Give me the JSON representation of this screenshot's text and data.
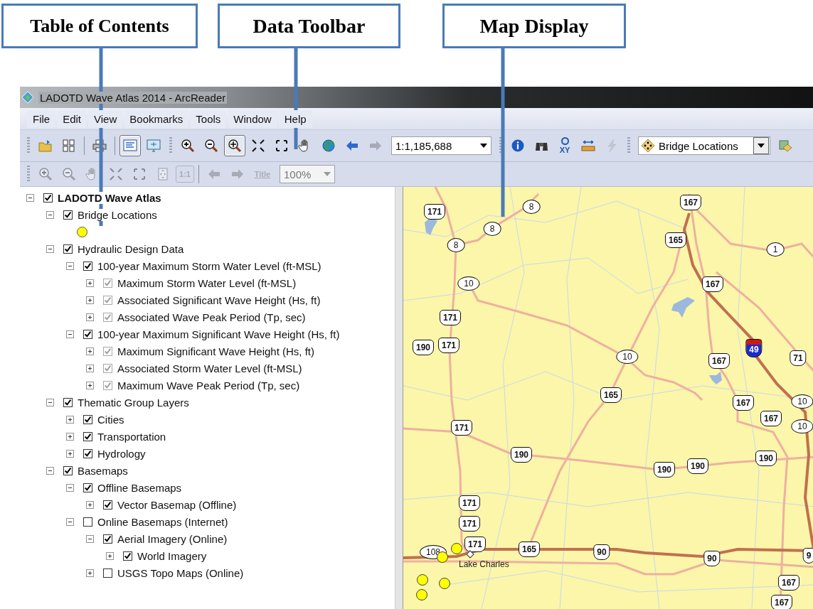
{
  "callouts": [
    {
      "text": "Table of Contents"
    },
    {
      "text": "Data Toolbar"
    },
    {
      "text": "Map Display"
    }
  ],
  "window": {
    "title": "LADOTD Wave Atlas 2014 - ArcReader"
  },
  "menu": [
    "File",
    "Edit",
    "View",
    "Bookmarks",
    "Tools",
    "Window",
    "Help"
  ],
  "toolbar_rows": [
    [
      {
        "kind": "grip"
      },
      {
        "kind": "open",
        "pressed": false,
        "disabled": false
      },
      {
        "kind": "pages",
        "pressed": false,
        "disabled": false
      },
      {
        "kind": "separator"
      },
      {
        "kind": "print",
        "pressed": false,
        "disabled": false
      },
      {
        "kind": "separator"
      },
      {
        "kind": "toc-view",
        "pressed": true,
        "disabled": false
      },
      {
        "kind": "data-view",
        "pressed": false,
        "disabled": false
      },
      {
        "kind": "grip"
      },
      {
        "kind": "zoom-in",
        "pressed": false,
        "disabled": false
      },
      {
        "kind": "zoom-out",
        "pressed": false,
        "disabled": false
      },
      {
        "kind": "pan-zoom",
        "pressed": true,
        "disabled": false
      },
      {
        "kind": "fixed-zoom-in",
        "pressed": false,
        "disabled": false
      },
      {
        "kind": "fixed-zoom-out",
        "pressed": false,
        "disabled": false
      },
      {
        "kind": "pan",
        "pressed": false,
        "disabled": false
      },
      {
        "kind": "full-extent",
        "pressed": false,
        "disabled": false
      },
      {
        "kind": "back",
        "pressed": false,
        "disabled": false
      },
      {
        "kind": "forward",
        "pressed": false,
        "disabled": true
      },
      {
        "kind": "combo",
        "value": "1:1,185,688",
        "disabled": false
      },
      {
        "kind": "grip"
      },
      {
        "kind": "identify",
        "pressed": false,
        "disabled": false
      },
      {
        "kind": "find",
        "pressed": false,
        "disabled": false
      },
      {
        "kind": "xy",
        "label": "XY",
        "pressed": false,
        "disabled": false
      },
      {
        "kind": "measure",
        "pressed": false,
        "disabled": false
      },
      {
        "kind": "flash",
        "pressed": false,
        "disabled": true
      },
      {
        "kind": "grip"
      },
      {
        "kind": "layer-combo",
        "value": "Bridge Locations",
        "disabled": false
      },
      {
        "kind": "layer-tool",
        "pressed": false,
        "disabled": false
      }
    ],
    [
      {
        "kind": "grip"
      },
      {
        "kind": "zoom-in",
        "pressed": false,
        "disabled": true
      },
      {
        "kind": "zoom-out",
        "pressed": false,
        "disabled": true
      },
      {
        "kind": "pan",
        "pressed": false,
        "disabled": true
      },
      {
        "kind": "fixed-zoom-in",
        "pressed": false,
        "disabled": true
      },
      {
        "kind": "fixed-zoom-out",
        "pressed": false,
        "disabled": true
      },
      {
        "kind": "whole-page",
        "pressed": false,
        "disabled": true
      },
      {
        "kind": "ratio",
        "label": "1:1",
        "pressed": false,
        "disabled": true
      },
      {
        "kind": "separator"
      },
      {
        "kind": "back",
        "pressed": false,
        "disabled": true
      },
      {
        "kind": "forward",
        "pressed": false,
        "disabled": true
      },
      {
        "kind": "text-tool",
        "label": "Title",
        "pressed": false,
        "disabled": true
      },
      {
        "kind": "combo",
        "value": "100%",
        "disabled": true
      }
    ]
  ],
  "toc": {
    "items": [
      {
        "kind": "layer",
        "label": "LADOTD Wave Atlas",
        "checked": true,
        "disabled": false,
        "expanded": true,
        "children": [
          {
            "kind": "layer",
            "label": "Bridge Locations",
            "checked": true,
            "disabled": false,
            "expanded": true,
            "children": [
              {
                "kind": "legend"
              }
            ]
          },
          {
            "kind": "layer",
            "label": "Hydraulic Design Data",
            "checked": true,
            "disabled": false,
            "expanded": true,
            "children": [
              {
                "kind": "layer",
                "label": "100-year Maximum Storm Water Level (ft-MSL)",
                "checked": true,
                "disabled": false,
                "expanded": true,
                "children": [
                  {
                    "kind": "layer",
                    "label": "Maximum Storm Water Level (ft-MSL)",
                    "checked": true,
                    "disabled": true,
                    "expanded": false
                  },
                  {
                    "kind": "layer",
                    "label": "Associated  Significant Wave Height (Hs, ft)",
                    "checked": true,
                    "disabled": true,
                    "expanded": false
                  },
                  {
                    "kind": "layer",
                    "label": "Associated Wave Peak Period (Tp, sec)",
                    "checked": true,
                    "disabled": true,
                    "expanded": false
                  }
                ]
              },
              {
                "kind": "layer",
                "label": "100-year Maximum Significant Wave Height (Hs, ft)",
                "checked": true,
                "disabled": false,
                "expanded": true,
                "children": [
                  {
                    "kind": "layer",
                    "label": "Maximum Significant Wave Height (Hs, ft)",
                    "checked": true,
                    "disabled": true,
                    "expanded": false
                  },
                  {
                    "kind": "layer",
                    "label": "Associated Storm Water Level (ft-MSL)",
                    "checked": true,
                    "disabled": true,
                    "expanded": false
                  },
                  {
                    "kind": "layer",
                    "label": "Maximum Wave Peak Period (Tp, sec)",
                    "checked": true,
                    "disabled": true,
                    "expanded": false
                  }
                ]
              }
            ]
          },
          {
            "kind": "layer",
            "label": "Thematic Group Layers",
            "checked": true,
            "disabled": false,
            "expanded": true,
            "children": [
              {
                "kind": "layer",
                "label": "Cities",
                "checked": true,
                "disabled": false,
                "expanded": false
              },
              {
                "kind": "layer",
                "label": "Transportation",
                "checked": true,
                "disabled": false,
                "expanded": false
              },
              {
                "kind": "layer",
                "label": "Hydrology",
                "checked": true,
                "disabled": false,
                "expanded": false
              }
            ]
          },
          {
            "kind": "layer",
            "label": "Basemaps",
            "checked": true,
            "disabled": false,
            "expanded": true,
            "children": [
              {
                "kind": "layer",
                "label": "Offline Basemaps",
                "checked": true,
                "disabled": false,
                "expanded": true,
                "children": [
                  {
                    "kind": "layer",
                    "label": "Vector Basemap (Offline)",
                    "checked": true,
                    "disabled": false,
                    "expanded": false
                  }
                ]
              },
              {
                "kind": "layer",
                "label": "Online Basemaps (Internet)",
                "checked": false,
                "disabled": false,
                "expanded": true,
                "children": [
                  {
                    "kind": "layer",
                    "label": "Aerial Imagery (Online)",
                    "checked": true,
                    "disabled": false,
                    "expanded": true,
                    "children": [
                      {
                        "kind": "layer",
                        "label": "World Imagery",
                        "checked": true,
                        "disabled": false,
                        "expanded": false
                      }
                    ]
                  },
                  {
                    "kind": "layer",
                    "label": "USGS Topo Maps (Online)",
                    "checked": false,
                    "disabled": false,
                    "expanded": false
                  }
                ]
              }
            ]
          }
        ]
      }
    ]
  },
  "map": {
    "shields": [
      {
        "kind": "us",
        "label": "171"
      },
      {
        "kind": "state",
        "label": "8"
      },
      {
        "kind": "us",
        "label": "167"
      },
      {
        "kind": "state",
        "label": "8"
      },
      {
        "kind": "state",
        "label": "8"
      },
      {
        "kind": "us",
        "label": "165"
      },
      {
        "kind": "state",
        "label": "1"
      },
      {
        "kind": "state",
        "label": "10"
      },
      {
        "kind": "us",
        "label": "167"
      },
      {
        "kind": "us",
        "label": "171"
      },
      {
        "kind": "us",
        "label": "190"
      },
      {
        "kind": "us",
        "label": "171"
      },
      {
        "kind": "state",
        "label": "10"
      },
      {
        "kind": "us",
        "label": "167"
      },
      {
        "kind": "interstate",
        "label": "49"
      },
      {
        "kind": "us",
        "label": "71"
      },
      {
        "kind": "us",
        "label": "165"
      },
      {
        "kind": "us",
        "label": "167"
      },
      {
        "kind": "state",
        "label": "10"
      },
      {
        "kind": "us",
        "label": "171"
      },
      {
        "kind": "us",
        "label": "167"
      },
      {
        "kind": "state",
        "label": "10"
      },
      {
        "kind": "us",
        "label": "190"
      },
      {
        "kind": "us",
        "label": "190"
      },
      {
        "kind": "us",
        "label": "190"
      },
      {
        "kind": "us",
        "label": "190"
      },
      {
        "kind": "us",
        "label": "171"
      },
      {
        "kind": "us",
        "label": "171"
      },
      {
        "kind": "state",
        "label": "108"
      },
      {
        "kind": "us",
        "label": "171"
      },
      {
        "kind": "us",
        "label": "165"
      },
      {
        "kind": "us",
        "label": "90"
      },
      {
        "kind": "us",
        "label": "90"
      },
      {
        "kind": "us",
        "label": "9"
      },
      {
        "kind": "us",
        "label": "167"
      },
      {
        "kind": "us",
        "label": "167"
      }
    ],
    "city": {
      "label": "Lake Charles"
    }
  }
}
